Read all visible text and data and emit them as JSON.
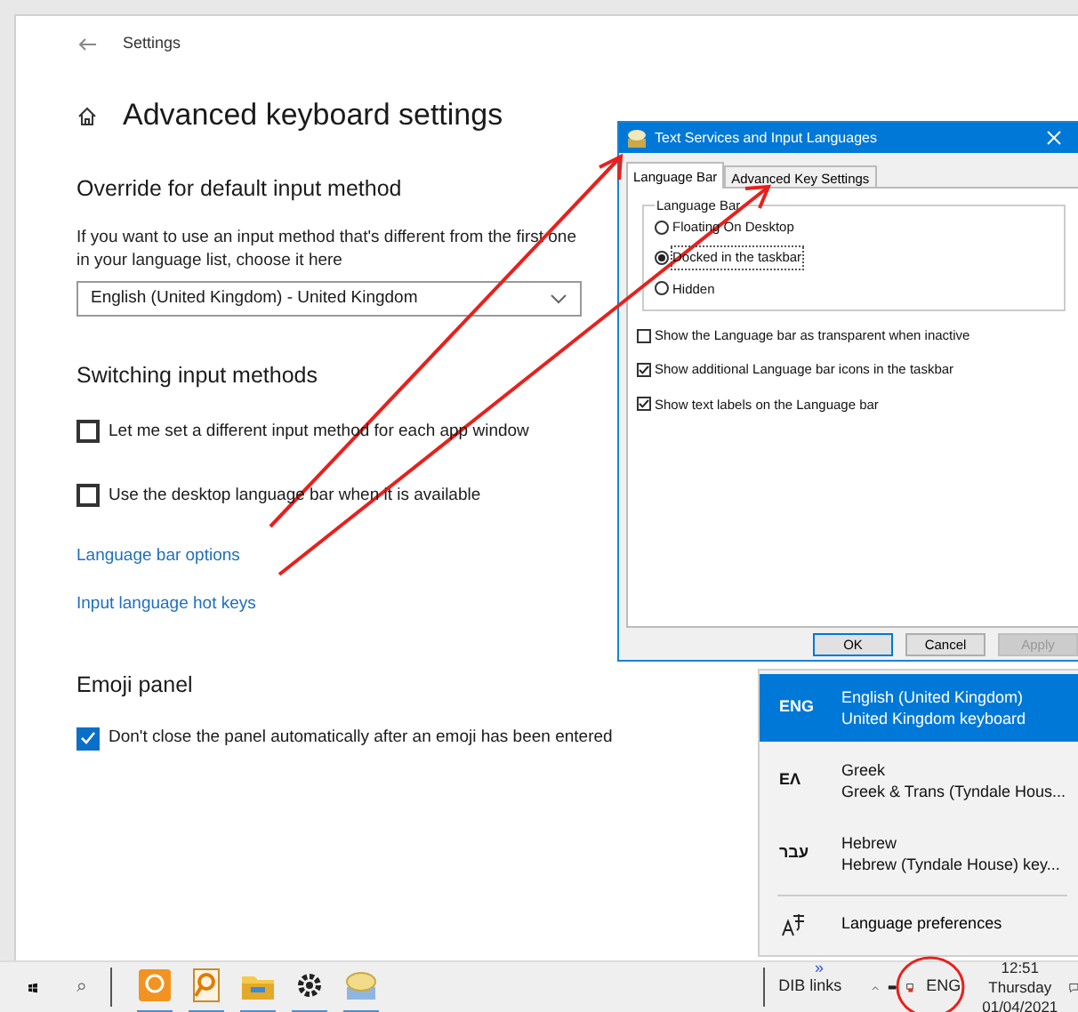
{
  "settings_window": {
    "title": "Settings",
    "page_title": "Advanced keyboard settings"
  },
  "override": {
    "heading": "Override for default input method",
    "description": "If you want to use an input method that's different from the first one in your language list, choose it here",
    "dropdown_value": "English (United Kingdom) - United Kingdom"
  },
  "switching": {
    "heading": "Switching input methods",
    "checkboxes": [
      {
        "label": "Let me set a different input method for each app window",
        "checked": false
      },
      {
        "label": "Use the desktop language bar when it is available",
        "checked": false
      }
    ],
    "links": [
      "Language bar options",
      "Input language hot keys"
    ]
  },
  "emoji": {
    "heading": "Emoji panel",
    "checkboxes": [
      {
        "label": "Don't close the panel automatically after an emoji has been entered",
        "checked": true
      }
    ]
  },
  "dialog": {
    "title": "Text Services and Input Languages",
    "tabs": [
      {
        "label": "Language Bar",
        "selected": true
      },
      {
        "label": "Advanced Key Settings",
        "selected": false
      }
    ],
    "group_label": "Language Bar",
    "radios": [
      {
        "label": "Floating On Desktop",
        "selected": false
      },
      {
        "label": "Docked in the taskbar",
        "selected": true
      },
      {
        "label": "Hidden",
        "selected": false
      }
    ],
    "checkboxes": [
      {
        "label": "Show the Language bar as transparent when inactive",
        "checked": false
      },
      {
        "label": "Show additional Language bar icons in the taskbar",
        "checked": true
      },
      {
        "label": "Show text labels on the Language bar",
        "checked": true
      }
    ],
    "buttons": [
      {
        "label": "OK",
        "disabled": false
      },
      {
        "label": "Cancel",
        "disabled": false
      },
      {
        "label": "Apply",
        "disabled": true
      }
    ]
  },
  "language_flyout": {
    "items": [
      {
        "code": "ENG",
        "name": "English (United Kingdom)",
        "keyboard": "United Kingdom keyboard",
        "selected": true
      },
      {
        "code": "EΛ",
        "name": "Greek",
        "keyboard": "Greek & Trans (Tyndale Hous...",
        "selected": false
      },
      {
        "code": "עבר",
        "name": "Hebrew",
        "keyboard": "Hebrew (Tyndale House) key...",
        "selected": false
      }
    ],
    "preferences": "Language preferences"
  },
  "taskbar": {
    "toolbar_label": "DIB links",
    "toolbar_overflow": "»",
    "language": "ENG",
    "time": "12:51",
    "day": "Thursday",
    "date": "01/04/2021"
  }
}
